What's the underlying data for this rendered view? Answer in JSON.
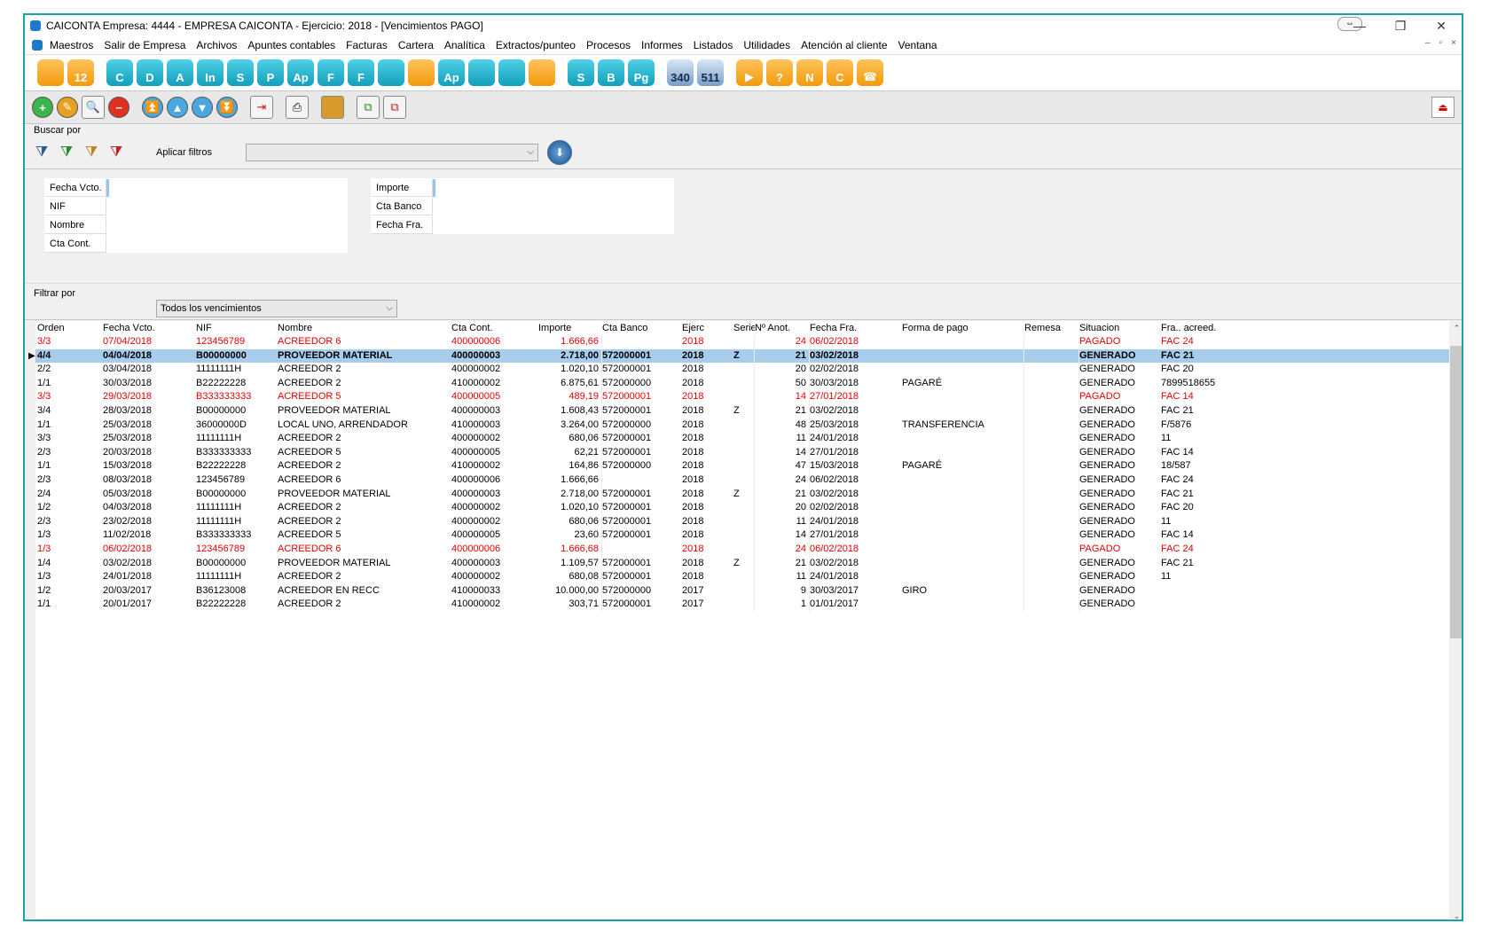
{
  "window": {
    "title": "CAICONTA Empresa: 4444 - EMPRESA CAICONTA - Ejercicio: 2018 - [Vencimientos PAGO]",
    "controls": [
      "—",
      "❐",
      "✕"
    ]
  },
  "menu": [
    "Maestros",
    "Salir de Empresa",
    "Archivos",
    "Apuntes contables",
    "Facturas",
    "Cartera",
    "Analítica",
    "Extractos/punteo",
    "Procesos",
    "Informes",
    "Listados",
    "Utilidades",
    "Atención al cliente",
    "Ventana"
  ],
  "mdi_controls": [
    "–",
    "▫",
    "×"
  ],
  "toolbar_main": [
    {
      "label": "",
      "icon": "blank-doc-icon",
      "style": "orange"
    },
    {
      "label": "12",
      "icon": "calendar-icon",
      "style": "orange"
    },
    {
      "label": "C",
      "icon": "clients-icon",
      "style": "teal"
    },
    {
      "label": "D",
      "icon": "d-icon",
      "style": "teal"
    },
    {
      "label": "A",
      "icon": "a-icon",
      "style": "teal"
    },
    {
      "label": "In",
      "icon": "in-icon",
      "style": "teal"
    },
    {
      "label": "S",
      "icon": "s-icon",
      "style": "teal"
    },
    {
      "label": "P",
      "icon": "p-icon",
      "style": "teal"
    },
    {
      "label": "Ap",
      "icon": "ap-icon",
      "style": "teal"
    },
    {
      "label": "F",
      "icon": "f-icon",
      "style": "teal"
    },
    {
      "label": "F",
      "icon": "f2-icon",
      "style": "teal"
    },
    {
      "label": "",
      "icon": "coin-icon",
      "style": "teal"
    },
    {
      "label": "",
      "icon": "coin2-icon",
      "style": "orange"
    },
    {
      "label": "Ap",
      "icon": "ap2-icon",
      "style": "teal"
    },
    {
      "label": "",
      "icon": "dh-icon",
      "style": "teal"
    },
    {
      "label": "",
      "icon": "lock-icon",
      "style": "teal"
    },
    {
      "label": "",
      "icon": "clipboard-icon",
      "style": "orange"
    },
    {
      "label": "S",
      "icon": "ss-icon",
      "style": "teal"
    },
    {
      "label": "B",
      "icon": "b-icon",
      "style": "teal"
    },
    {
      "label": "Pg",
      "icon": "pg-icon",
      "style": "teal"
    },
    {
      "label": "340",
      "icon": "model-340-icon",
      "style": "blue2"
    },
    {
      "label": "511",
      "icon": "model-511-icon",
      "style": "blue2"
    },
    {
      "label": "▶",
      "icon": "play-icon",
      "style": "orange"
    },
    {
      "label": "?",
      "icon": "help-icon",
      "style": "orange"
    },
    {
      "label": "N",
      "icon": "n-icon",
      "style": "orange"
    },
    {
      "label": "C",
      "icon": "c-icon",
      "style": "orange"
    },
    {
      "label": "☎",
      "icon": "support-icon",
      "style": "orange"
    }
  ],
  "search": {
    "section_label": "Buscar por",
    "apply_label": "Aplicar filtros",
    "apply_combo_value": "",
    "left_fields": [
      "Fecha Vcto.",
      "NIF",
      "Nombre",
      "Cta Cont."
    ],
    "right_fields": [
      "Importe",
      "Cta Banco",
      "Fecha Fra."
    ]
  },
  "filter": {
    "section_label": "Filtrar por",
    "selected": "Todos los vencimientos"
  },
  "grid": {
    "columns": [
      "Orden",
      "Fecha Vcto.",
      "NIF",
      "Nombre",
      "Cta Cont.",
      "Importe",
      "Cta Banco",
      "Ejerc",
      "Serie",
      "Nº Anot.",
      "Fecha Fra.",
      "Forma de pago",
      "Remesa",
      "Situacion",
      "Fra.. acreed."
    ],
    "rows": [
      {
        "c": [
          "3/3",
          "07/04/2018",
          "123456789",
          "ACREEDOR 6",
          "400000006",
          "1.666,66",
          "",
          "2018",
          "",
          "24",
          "06/02/2018",
          "",
          "",
          "PAGADO",
          "FAC 24"
        ],
        "state": "red"
      },
      {
        "c": [
          "4/4",
          "04/04/2018",
          "B00000000",
          "PROVEEDOR MATERIAL",
          "400000003",
          "2.718,00",
          "572000001",
          "2018",
          "Z",
          "21",
          "03/02/2018",
          "",
          "",
          "GENERADO",
          "FAC 21"
        ],
        "state": "sel"
      },
      {
        "c": [
          "2/2",
          "03/04/2018",
          "11111111H",
          "ACREEDOR 2",
          "400000002",
          "1.020,10",
          "572000001",
          "2018",
          "",
          "20",
          "02/02/2018",
          "",
          "",
          "GENERADO",
          "FAC 20"
        ],
        "state": ""
      },
      {
        "c": [
          "1/1",
          "30/03/2018",
          "B22222228",
          "ACREEDOR 2",
          "410000002",
          "6.875,61",
          "572000000",
          "2018",
          "",
          "50",
          "30/03/2018",
          "PAGARÉ",
          "",
          "GENERADO",
          "7899518655"
        ],
        "state": ""
      },
      {
        "c": [
          "3/3",
          "29/03/2018",
          "B333333333",
          "ACREEDOR 5",
          "400000005",
          "489,19",
          "572000001",
          "2018",
          "",
          "14",
          "27/01/2018",
          "",
          "",
          "PAGADO",
          "FAC 14"
        ],
        "state": "red"
      },
      {
        "c": [
          "3/4",
          "28/03/2018",
          "B00000000",
          "PROVEEDOR MATERIAL",
          "400000003",
          "1.608,43",
          "572000001",
          "2018",
          "Z",
          "21",
          "03/02/2018",
          "",
          "",
          "GENERADO",
          "FAC 21"
        ],
        "state": ""
      },
      {
        "c": [
          "1/1",
          "25/03/2018",
          "36000000D",
          "LOCAL UNO, ARRENDADOR",
          "410000003",
          "3.264,00",
          "572000000",
          "2018",
          "",
          "48",
          "25/03/2018",
          "TRANSFERENCIA",
          "",
          "GENERADO",
          "F/5876"
        ],
        "state": ""
      },
      {
        "c": [
          "3/3",
          "25/03/2018",
          "11111111H",
          "ACREEDOR 2",
          "400000002",
          "680,06",
          "572000001",
          "2018",
          "",
          "11",
          "24/01/2018",
          "",
          "",
          "GENERADO",
          "11"
        ],
        "state": ""
      },
      {
        "c": [
          "2/3",
          "20/03/2018",
          "B333333333",
          "ACREEDOR 5",
          "400000005",
          "62,21",
          "572000001",
          "2018",
          "",
          "14",
          "27/01/2018",
          "",
          "",
          "GENERADO",
          "FAC 14"
        ],
        "state": ""
      },
      {
        "c": [
          "1/1",
          "15/03/2018",
          "B22222228",
          "ACREEDOR 2",
          "410000002",
          "164,86",
          "572000000",
          "2018",
          "",
          "47",
          "15/03/2018",
          "PAGARÉ",
          "",
          "GENERADO",
          "18/587"
        ],
        "state": ""
      },
      {
        "c": [
          "2/3",
          "08/03/2018",
          "123456789",
          "ACREEDOR 6",
          "400000006",
          "1.666,66",
          "",
          "2018",
          "",
          "24",
          "06/02/2018",
          "",
          "",
          "GENERADO",
          "FAC 24"
        ],
        "state": ""
      },
      {
        "c": [
          "2/4",
          "05/03/2018",
          "B00000000",
          "PROVEEDOR MATERIAL",
          "400000003",
          "2.718,00",
          "572000001",
          "2018",
          "Z",
          "21",
          "03/02/2018",
          "",
          "",
          "GENERADO",
          "FAC 21"
        ],
        "state": ""
      },
      {
        "c": [
          "1/2",
          "04/03/2018",
          "11111111H",
          "ACREEDOR 2",
          "400000002",
          "1.020,10",
          "572000001",
          "2018",
          "",
          "20",
          "02/02/2018",
          "",
          "",
          "GENERADO",
          "FAC 20"
        ],
        "state": ""
      },
      {
        "c": [
          "2/3",
          "23/02/2018",
          "11111111H",
          "ACREEDOR 2",
          "400000002",
          "680,06",
          "572000001",
          "2018",
          "",
          "11",
          "24/01/2018",
          "",
          "",
          "GENERADO",
          "11"
        ],
        "state": ""
      },
      {
        "c": [
          "1/3",
          "11/02/2018",
          "B333333333",
          "ACREEDOR 5",
          "400000005",
          "23,60",
          "572000001",
          "2018",
          "",
          "14",
          "27/01/2018",
          "",
          "",
          "GENERADO",
          "FAC 14"
        ],
        "state": ""
      },
      {
        "c": [
          "1/3",
          "06/02/2018",
          "123456789",
          "ACREEDOR 6",
          "400000006",
          "1.666,68",
          "",
          "2018",
          "",
          "24",
          "06/02/2018",
          "",
          "",
          "PAGADO",
          "FAC 24"
        ],
        "state": "red"
      },
      {
        "c": [
          "1/4",
          "03/02/2018",
          "B00000000",
          "PROVEEDOR MATERIAL",
          "400000003",
          "1.109,57",
          "572000001",
          "2018",
          "Z",
          "21",
          "03/02/2018",
          "",
          "",
          "GENERADO",
          "FAC 21"
        ],
        "state": ""
      },
      {
        "c": [
          "1/3",
          "24/01/2018",
          "11111111H",
          "ACREEDOR 2",
          "400000002",
          "680,08",
          "572000001",
          "2018",
          "",
          "11",
          "24/01/2018",
          "",
          "",
          "GENERADO",
          "11"
        ],
        "state": ""
      },
      {
        "c": [
          "1/2",
          "20/03/2017",
          "B36123008",
          "ACREEDOR EN RECC",
          "410000033",
          "10.000,00",
          "572000000",
          "2017",
          "",
          "9",
          "30/03/2017",
          "GIRO",
          "",
          "GENERADO",
          ""
        ],
        "state": ""
      },
      {
        "c": [
          "1/1",
          "20/01/2017",
          "B22222228",
          "ACREEDOR 2",
          "410000002",
          "303,71",
          "572000001",
          "2017",
          "",
          "1",
          "01/01/2017",
          "",
          "",
          "GENERADO",
          ""
        ],
        "state": ""
      }
    ]
  }
}
